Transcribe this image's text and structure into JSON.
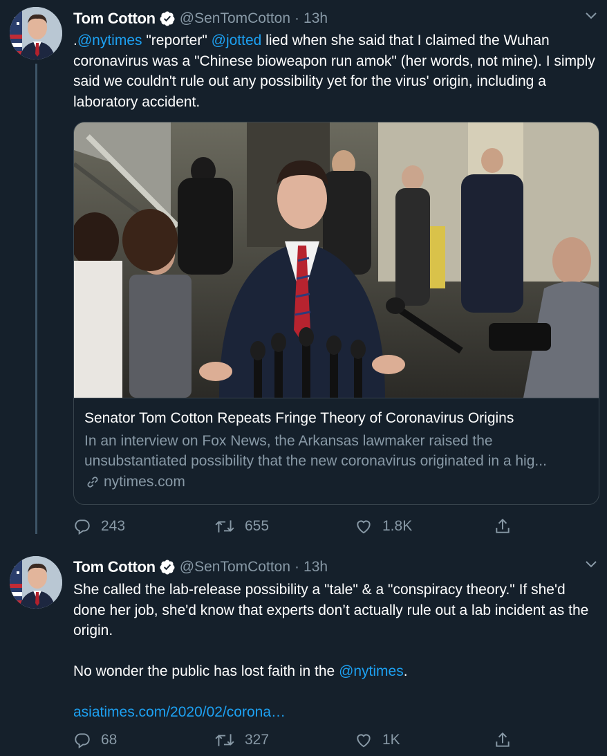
{
  "tweets": [
    {
      "name": "Tom Cotton",
      "handle": "@SenTomCotton",
      "separator": "·",
      "time": "13h",
      "text": {
        "p1": ".",
        "m1": "@nytimes",
        "p2": " \"reporter\" ",
        "m2": "@jotted",
        "p3": " lied when she said that I claimed the Wuhan coronavirus was a \"Chinese bioweapon run amok\" (her words, not mine). I simply said we couldn't rule out any possibility yet for the virus' origin, including a laboratory accident."
      },
      "card": {
        "title": "Senator Tom Cotton Repeats Fringe Theory of Coronavirus Origins",
        "description": "In an interview on Fox News, the Arkansas lawmaker raised the unsubstantiated possibility that the new coronavirus originated in a hig...",
        "domain": "nytimes.com"
      },
      "actions": {
        "replies": "243",
        "retweets": "655",
        "likes": "1.8K"
      }
    },
    {
      "name": "Tom Cotton",
      "handle": "@SenTomCotton",
      "separator": "·",
      "time": "13h",
      "text": {
        "line1": "She called the lab-release possibility a \"tale\" & a \"conspiracy theory.\" If she'd done her job, she'd know that experts don’t actually rule out a lab incident as the origin.",
        "p2a": "No wonder the public has lost faith in the ",
        "m1": "@nytimes",
        "p2b": ".",
        "link": "asiatimes.com/2020/02/corona…"
      },
      "actions": {
        "replies": "68",
        "retweets": "327",
        "likes": "1K"
      }
    }
  ],
  "colors": {
    "background": "#15202b",
    "text_primary": "#ffffff",
    "text_secondary": "#8899a6",
    "link": "#1da1f2",
    "border": "#38444d"
  },
  "icons": [
    "verified-badge-icon",
    "caret-down-icon",
    "reply-icon",
    "retweet-icon",
    "like-icon",
    "share-icon",
    "link-icon"
  ]
}
